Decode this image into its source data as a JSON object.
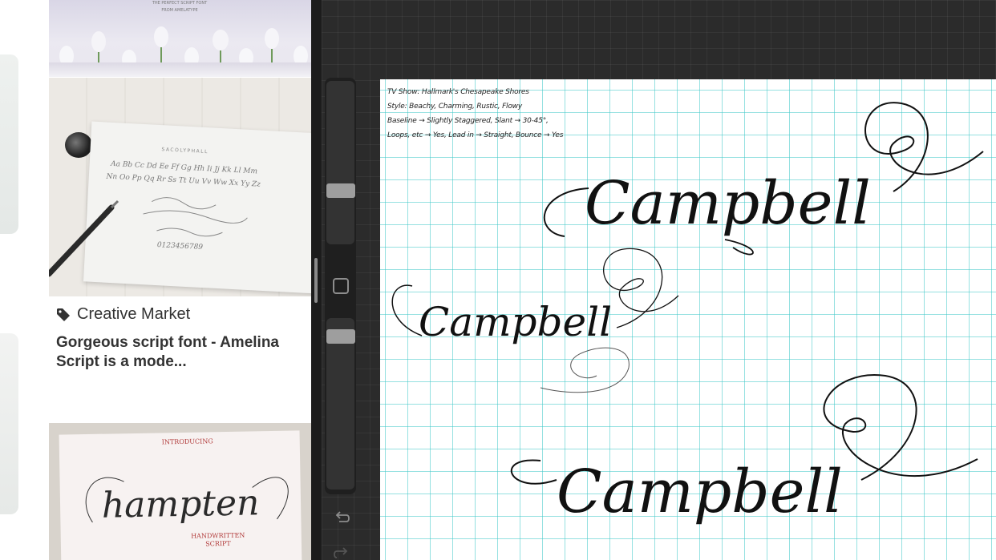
{
  "left_pane": {
    "pin_source": "Creative Market",
    "pin_title": "Gorgeous script font - Amelina Script is a mode...",
    "top_banner_text": [
      "THE PERFECT SCRIPT FONT",
      "FROM AMELATYPE"
    ],
    "amelina_card": {
      "brand": "SACOLYPHALL",
      "alphabet_line_1": "Aa Bb Cc Dd Ee Ff Gg Hh Ii Jj Kk Ll Mm",
      "alphabet_line_2": "Nn Oo Pp Qq Rr Ss Tt Uu Vv Ww Xx Yy Zz",
      "numbers": "0123456789"
    },
    "hampton_card": {
      "introducing": "INTRODUCING",
      "name": "hampten",
      "subtitle": "HANDWRITTEN\nSCRIPT"
    }
  },
  "canvas": {
    "notes": [
      "TV Show: Hallmark's Chesapeake Shores",
      "Style: Beachy, Charming, Rustic, Flowy",
      "Baseline → Slightly Staggered, Slant → 30-45°,",
      "Loops, etc → Yes, Lead in → Straight, Bounce → Yes"
    ],
    "lettering_word": "Campbell"
  },
  "colors": {
    "canvas_bg": "#2b2b2b",
    "grid_line": "#40c8c8",
    "ink": "#111111",
    "slider_thumb": "#9e9e9e"
  },
  "icons": {
    "source": "tag-icon",
    "modify": "square-icon",
    "undo": "undo-icon",
    "redo": "redo-icon"
  }
}
